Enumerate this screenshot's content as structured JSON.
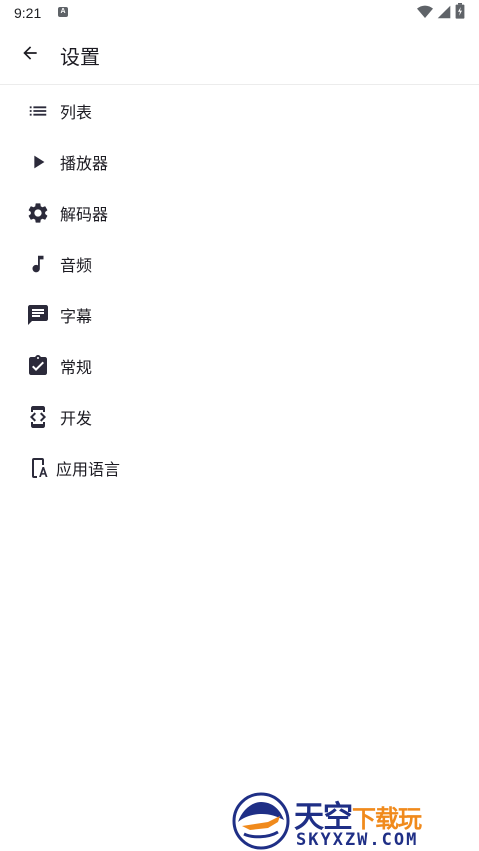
{
  "status_bar": {
    "time": "9:21",
    "notification_letter": "A",
    "wifi_icon": "wifi-icon",
    "signal_icon": "signal-icon",
    "battery_icon": "battery-charging-icon"
  },
  "toolbar": {
    "back_icon": "arrow-back-icon",
    "title": "设置"
  },
  "settings": {
    "items": [
      {
        "label": "列表",
        "icon": "list-icon"
      },
      {
        "label": "播放器",
        "icon": "play-icon"
      },
      {
        "label": "解码器",
        "icon": "gear-icon"
      },
      {
        "label": "音频",
        "icon": "music-note-icon"
      },
      {
        "label": "字幕",
        "icon": "subtitles-icon"
      },
      {
        "label": "常规",
        "icon": "clipboard-check-icon"
      },
      {
        "label": "开发",
        "icon": "developer-mode-icon"
      },
      {
        "label": "应用语言",
        "icon": "app-language-icon"
      }
    ]
  },
  "watermark": {
    "cn_main": "天空",
    "cn_accent": "下载玩",
    "en": "SKYXZW.COM",
    "colors": {
      "navy": "#1f2f86",
      "orange": "#f08a1c"
    }
  },
  "colors": {
    "icon": "#2b2a3a",
    "text": "#1c1b22",
    "divider": "#ececec"
  }
}
